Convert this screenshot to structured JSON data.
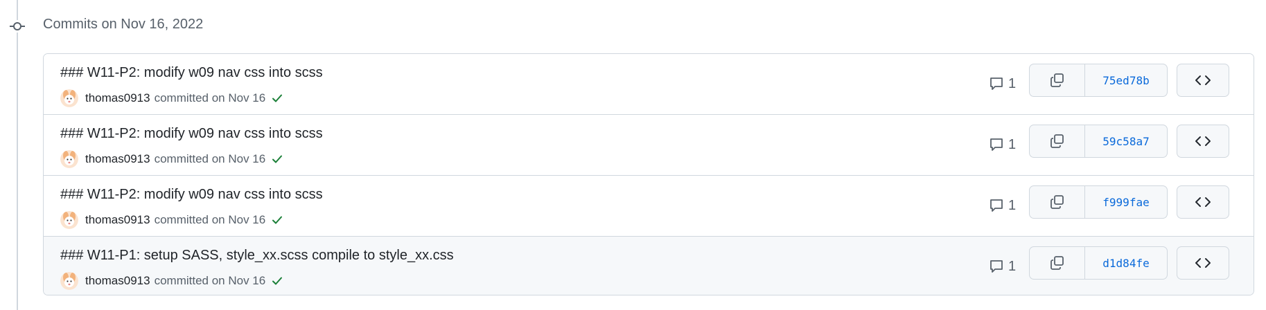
{
  "group": {
    "title": "Commits on Nov 16, 2022"
  },
  "commits": [
    {
      "title": "### W11-P2: modify w09 nav css into scss",
      "author": "thomas0913",
      "committed_text": "committed on Nov 16",
      "comments": "1",
      "sha": "75ed78b",
      "status": "success"
    },
    {
      "title": "### W11-P2: modify w09 nav css into scss",
      "author": "thomas0913",
      "committed_text": "committed on Nov 16",
      "comments": "1",
      "sha": "59c58a7",
      "status": "success"
    },
    {
      "title": "### W11-P2: modify w09 nav css into scss",
      "author": "thomas0913",
      "committed_text": "committed on Nov 16",
      "comments": "1",
      "sha": "f999fae",
      "status": "success"
    },
    {
      "title": "### W11-P1: setup SASS, style_xx.scss compile to style_xx.css",
      "author": "thomas0913",
      "committed_text": "committed on Nov 16",
      "comments": "1",
      "sha": "d1d84fe",
      "status": "success"
    }
  ],
  "icons": {
    "timeline": "git-commit-icon",
    "comment": "comment-icon",
    "copy": "copy-icon",
    "browse": "code-icon",
    "status": "check-icon",
    "avatar": "avatar"
  },
  "colors": {
    "link": "#0969da",
    "success": "#1a7f37",
    "border": "#d0d7de",
    "muted": "#57606a",
    "button_bg": "#f6f8fa"
  }
}
